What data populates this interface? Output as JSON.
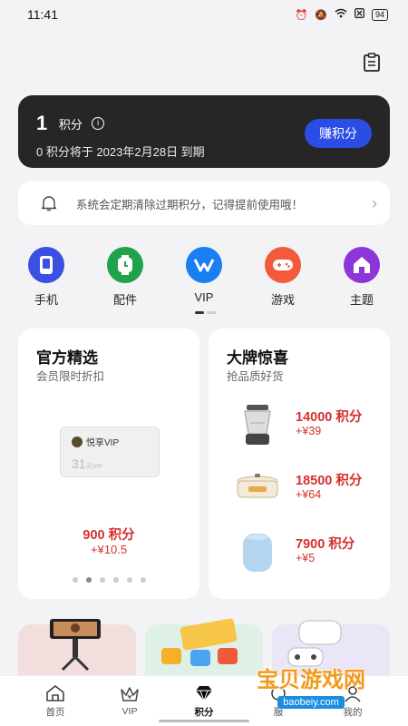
{
  "status_bar": {
    "time": "11:41",
    "battery": "94"
  },
  "points_card": {
    "points": "1",
    "label": "积分",
    "expire_notice": "0 积分将于 2023年2月28日 到期",
    "earn_button": "赚积分"
  },
  "notice": {
    "text": "系统会定期清除过期积分，记得提前使用哦！"
  },
  "categories": [
    {
      "label": "手机",
      "icon": "phone-icon",
      "color": "#3b4fe0"
    },
    {
      "label": "配件",
      "icon": "accessory-icon",
      "color": "#20a24a"
    },
    {
      "label": "VIP",
      "icon": "vip-icon",
      "color": "#1a7ff0"
    },
    {
      "label": "游戏",
      "icon": "gamepad-icon",
      "color": "#f25a3b"
    },
    {
      "label": "主题",
      "icon": "home-theme-icon",
      "color": "#8c35d8"
    }
  ],
  "official": {
    "title": "官方精选",
    "subtitle": "会员限时折扣",
    "card_logo": "悦享VIP",
    "card_days": "31",
    "card_days_unit": "天VIP",
    "price": "900 积分",
    "cash": "+¥10.5"
  },
  "brand": {
    "title": "大牌惊喜",
    "subtitle": "抢品质好货",
    "products": [
      {
        "price": "14000 积分",
        "cash": "+¥39",
        "icon": "blender-icon"
      },
      {
        "price": "18500 积分",
        "cash": "+¥64",
        "icon": "cooker-icon"
      },
      {
        "price": "7900 积分",
        "cash": "+¥5",
        "icon": "humidifier-icon"
      }
    ]
  },
  "nav": [
    {
      "label": "首页",
      "icon": "home-icon"
    },
    {
      "label": "VIP",
      "icon": "crown-icon"
    },
    {
      "label": "积分",
      "icon": "diamond-icon"
    },
    {
      "label": "服",
      "icon": "service-icon"
    },
    {
      "label": "我的",
      "icon": "profile-icon"
    }
  ],
  "watermark": {
    "main": "宝贝游戏网",
    "sub": "baobeiy.com"
  },
  "colors": {
    "accent": "#2b4de6",
    "price": "#d5312e",
    "card_dark": "#262626"
  }
}
